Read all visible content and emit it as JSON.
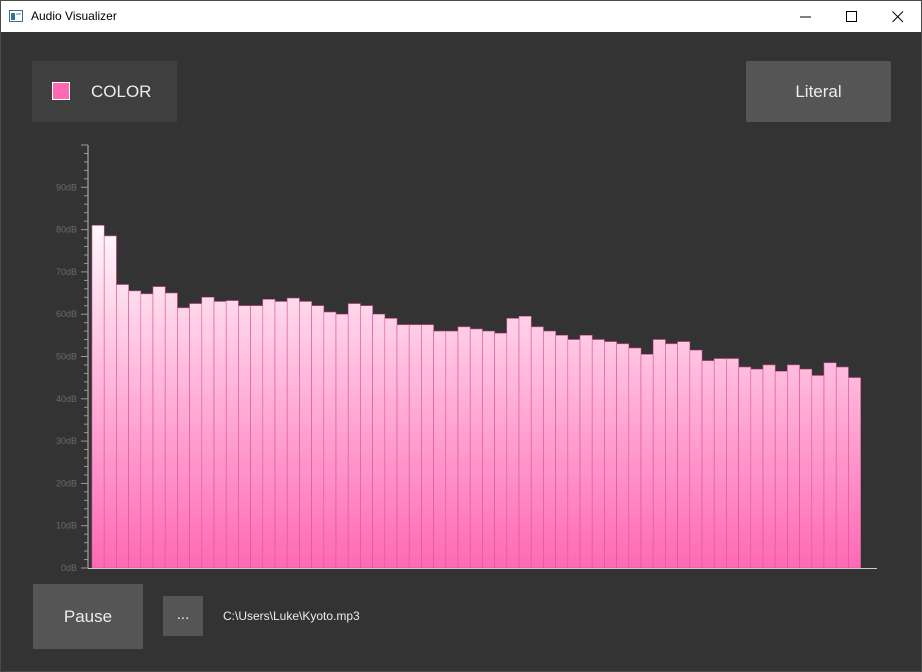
{
  "window": {
    "title": "Audio Visualizer",
    "icons": {
      "app": "app-window-icon",
      "minimize": "minimize-icon",
      "maximize": "maximize-icon",
      "close": "close-icon"
    }
  },
  "controls": {
    "color_label": "COLOR",
    "color_value": "#ff69b4",
    "mode_label": "Literal",
    "pause_label": "Pause",
    "browse_label": "...",
    "file_path": "C:\\Users\\Luke\\Kyoto.mp3"
  },
  "colors": {
    "background": "#333333",
    "bar_top": "#ffffff",
    "bar_bottom": "#ff69b4"
  },
  "chart_data": {
    "type": "bar",
    "title": "",
    "xlabel": "",
    "ylabel": "",
    "ylim": [
      0,
      100
    ],
    "tick_values": [
      0,
      10,
      20,
      30,
      40,
      50,
      60,
      70,
      80,
      90
    ],
    "tick_labels": [
      "0dB",
      "10dB",
      "20dB",
      "30dB",
      "40dB",
      "50dB",
      "60dB",
      "70dB",
      "80dB",
      "90dB"
    ],
    "values": [
      81,
      78.5,
      67,
      65.5,
      64.8,
      66.5,
      65,
      61.5,
      62.5,
      64,
      63,
      63.2,
      62,
      62,
      63.5,
      63,
      63.8,
      63,
      62,
      60.5,
      60,
      62.5,
      62,
      60,
      59,
      57.5,
      57.5,
      57.5,
      56,
      56,
      57,
      56.5,
      56,
      55.5,
      59,
      59.5,
      57,
      56,
      55,
      54,
      55,
      54,
      53.5,
      53,
      52,
      50.5,
      54,
      53,
      53.5,
      51.5,
      49,
      49.5,
      49.5,
      47.5,
      47,
      48,
      46.5,
      48,
      47,
      45.5,
      48.5,
      47.5,
      45
    ]
  }
}
